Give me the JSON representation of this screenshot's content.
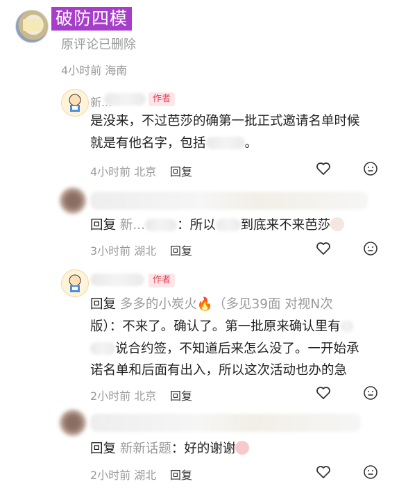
{
  "top_comment": {
    "title_badge": "破防四模",
    "deleted_text": "原评论已删除",
    "time": "4小时前",
    "location": "海南"
  },
  "replies": [
    {
      "name": "新...",
      "author_tag": "作者",
      "text_1": "是没来，不过芭莎的确第一批正式邀请名单时候",
      "text_2": "就是有他名字，包括",
      "text_2_tail": "。",
      "time": "4小时前",
      "location": "北京",
      "reply": "回复"
    },
    {
      "prefix": "回复",
      "mention": "新...",
      "text": "：所以",
      "text_mid": "到底来不来芭莎",
      "emoji": "cat-face-emoji",
      "time": "3小时前",
      "location": "湖北",
      "reply": "回复"
    },
    {
      "author_tag": "作者",
      "prefix": "回复",
      "mention": "多多的小炭火🔥（多见39面 对视N次",
      "line_1_cont": "",
      "line_2_a": "版）：不来了。确认了。第一批原来确认里有",
      "line_3": "说合约签，不知道后来怎么没了。一开始承",
      "line_4": "诺名单和后面有出入，所以这次活动也办的急",
      "time": "2小时前",
      "location": "北京",
      "reply": "回复"
    },
    {
      "prefix": "回复",
      "mention": "新新话题",
      "text": "：好的谢谢",
      "emoji": "pig-face-emoji",
      "time": "2小时前",
      "location": "湖北",
      "reply": "回复"
    }
  ],
  "icons": {
    "like": "heart-icon",
    "more": "face-icon"
  },
  "colors": {
    "badge_bg": "#a63ec9",
    "author_tag_text": "#e0445a",
    "meta": "#9a9a9a"
  }
}
